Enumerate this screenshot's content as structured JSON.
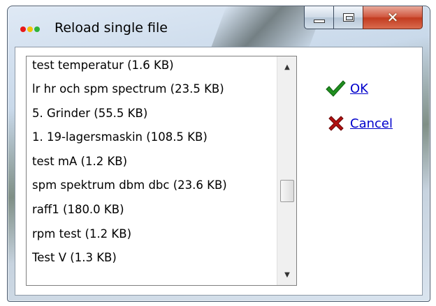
{
  "window": {
    "title": "Reload single file",
    "buttons": {
      "minimize": "minimize",
      "maximize": "maximize",
      "close": "close"
    }
  },
  "file_list": {
    "items": [
      "test temperatur  (1.6 KB)",
      "lr hr och spm spectrum  (23.5 KB)",
      "5. Grinder   (55.5 KB)",
      "1. 19-lagersmaskin   (108.5 KB)",
      "test mA  (1.2 KB)",
      "spm spektrum dbm dbc  (23.6 KB)",
      "raff1  (180.0 KB)",
      "rpm test  (1.2 KB)",
      "Test V  (1.3 KB)"
    ],
    "scroll_position": 0.62
  },
  "actions": {
    "ok_label": "OK",
    "cancel_label": "Cancel"
  },
  "colors": {
    "link": "#0000cc",
    "ok_check": "#1f8f1f",
    "cancel_x": "#b01010",
    "close_button": "#c9452a"
  },
  "icons": {
    "app": "traffic-light-dots-icon",
    "ok": "green-checkmark-icon",
    "cancel": "red-x-icon"
  }
}
